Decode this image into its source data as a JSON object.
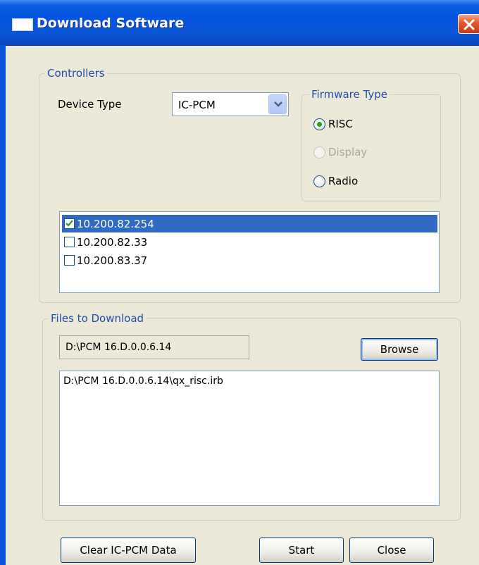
{
  "window": {
    "title": "Download Software"
  },
  "controllers": {
    "legend": "Controllers",
    "device_type_label": "Device Type",
    "device_type_value": "IC-PCM",
    "firmware": {
      "legend": "Firmware Type",
      "options": [
        {
          "label": "RISC",
          "selected": true,
          "enabled": true
        },
        {
          "label": "Display",
          "selected": false,
          "enabled": false
        },
        {
          "label": "Radio",
          "selected": false,
          "enabled": true
        }
      ]
    },
    "ips": [
      {
        "ip": "10.200.82.254",
        "checked": true,
        "selected": true
      },
      {
        "ip": "10.200.82.33",
        "checked": false,
        "selected": false
      },
      {
        "ip": "10.200.83.37",
        "checked": false,
        "selected": false
      }
    ]
  },
  "files": {
    "legend": "Files to Download",
    "path": "D:\\PCM 16.D.0.0.6.14",
    "browse_label": "Browse",
    "list": [
      "D:\\PCM 16.D.0.0.6.14\\qx_risc.irb"
    ]
  },
  "buttons": {
    "clear_label": "Clear IC-PCM Data",
    "start_label": "Start",
    "close_label": "Close"
  }
}
